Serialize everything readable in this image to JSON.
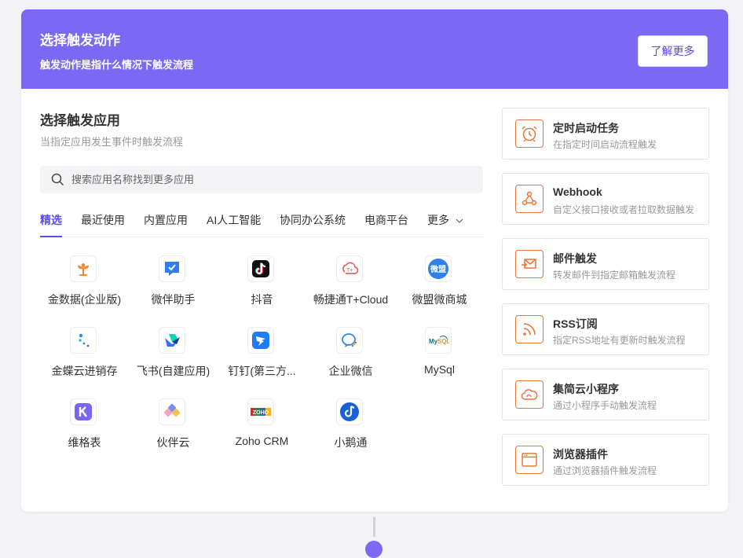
{
  "header": {
    "title": "选择触发动作",
    "subtitle": "触发动作是指什么情况下触发流程",
    "learn_more": "了解更多"
  },
  "section": {
    "title": "选择触发应用",
    "subtitle": "当指定应用发生事件时触发流程"
  },
  "search": {
    "placeholder": "搜索应用名称找到更多应用",
    "value": ""
  },
  "tabs": [
    {
      "label": "精选",
      "active": true
    },
    {
      "label": "最近使用"
    },
    {
      "label": "内置应用"
    },
    {
      "label": "AI人工智能"
    },
    {
      "label": "协同办公系统"
    },
    {
      "label": "电商平台"
    },
    {
      "label": "更多"
    }
  ],
  "apps": [
    {
      "label": "金数据(企业版)",
      "icon": "jinshuju-icon"
    },
    {
      "label": "微伴助手",
      "icon": "weiban-icon"
    },
    {
      "label": "抖音",
      "icon": "douyin-icon"
    },
    {
      "label": "畅捷通T+Cloud",
      "icon": "chanjet-icon"
    },
    {
      "label": "微盟微商城",
      "icon": "weimob-icon"
    },
    {
      "label": "金蝶云进销存",
      "icon": "kingdee-icon"
    },
    {
      "label": "飞书(自建应用)",
      "icon": "feishu-icon"
    },
    {
      "label": "钉钉(第三方...",
      "icon": "dingtalk-icon"
    },
    {
      "label": "企业微信",
      "icon": "wecom-icon"
    },
    {
      "label": "MySql",
      "icon": "mysql-icon"
    },
    {
      "label": "维格表",
      "icon": "vika-icon"
    },
    {
      "label": "伙伴云",
      "icon": "huoban-icon"
    },
    {
      "label": "Zoho CRM",
      "icon": "zoho-icon"
    },
    {
      "label": "小鹅通",
      "icon": "xiaoe-icon"
    }
  ],
  "triggers": [
    {
      "title": "定时启动任务",
      "subtitle": "在指定时间启动流程触发",
      "icon": "alarm-clock-icon"
    },
    {
      "title": "Webhook",
      "subtitle": "自定义接口接收或者拉取数据触发",
      "icon": "webhook-icon"
    },
    {
      "title": "邮件触发",
      "subtitle": "转发邮件到指定邮箱触发流程",
      "icon": "mail-icon"
    },
    {
      "title": "RSS订阅",
      "subtitle": "指定RSS地址有更新时触发流程",
      "icon": "rss-icon"
    },
    {
      "title": "集简云小程序",
      "subtitle": "通过小程序手动触发流程",
      "icon": "cloud-icon"
    },
    {
      "title": "浏览器插件",
      "subtitle": "通过浏览器插件触发流程",
      "icon": "browser-icon"
    }
  ],
  "colors": {
    "header_bg": "#7b69f3",
    "accent": "#5b4de6",
    "trigger_icon": "#e8763c"
  }
}
